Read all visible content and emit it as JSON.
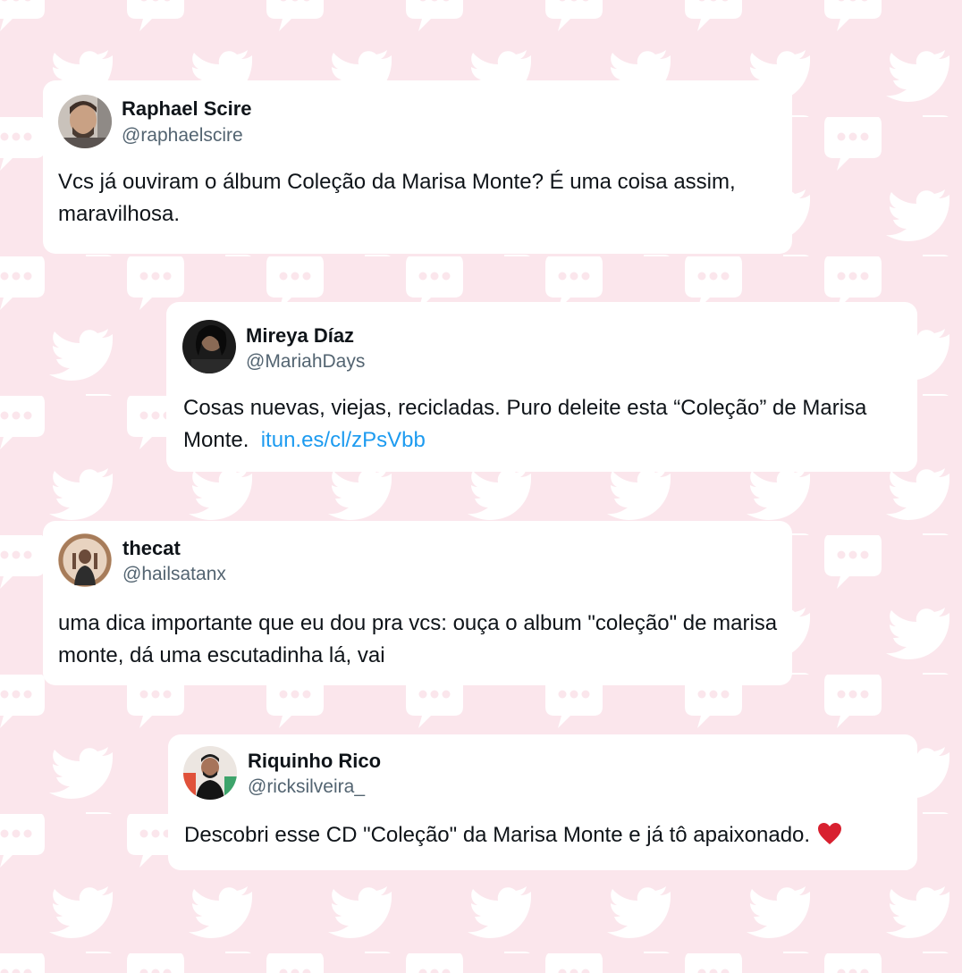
{
  "tweets": [
    {
      "name": "Raphael Scire",
      "handle": "@raphaelscire",
      "text": "Vcs já ouviram o álbum Coleção da Marisa Monte? É uma coisa assim, maravilhosa."
    },
    {
      "name": "Mireya Díaz",
      "handle": "@MariahDays",
      "text": "Cosas nuevas, viejas, recicladas. Puro deleite esta “Coleção” de Marisa Monte.",
      "link": "itun.es/cl/zPsVbb"
    },
    {
      "name": "thecat",
      "handle": "@hailsatanx",
      "text": "uma dica importante que eu dou pra vcs: ouça o album \"coleção\" de marisa monte, dá uma escutadinha lá, vai"
    },
    {
      "name": "Riquinho Rico",
      "handle": "@ricksilveira_",
      "text": "Descobri esse CD \"Coleção\" da Marisa Monte e já tô apaixonado.",
      "emoji": "heart-icon"
    }
  ],
  "colors": {
    "background": "#fbe6ec",
    "pattern": "#ffffff",
    "card": "#ffffff",
    "name": "#0f1419",
    "handle": "#536471",
    "link": "#1d9bf0",
    "heart": "#d8202f"
  }
}
